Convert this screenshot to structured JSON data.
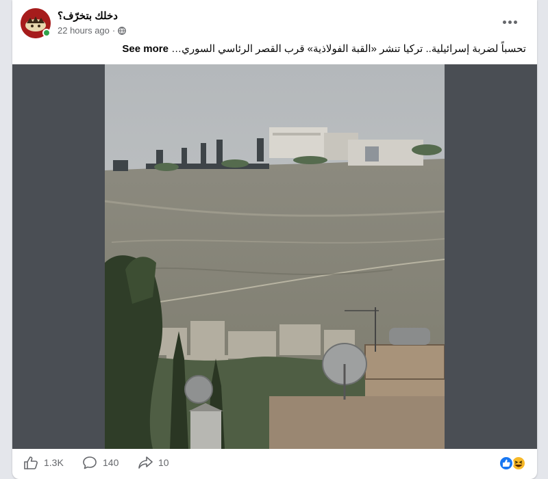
{
  "post": {
    "page_name": "دخلك بتخرّف؟",
    "timestamp": "22 hours ago",
    "separator": "·",
    "privacy_icon": "globe-icon",
    "caption_text": "تحسباً لضربة إسرائيلية.. تركيا تنشر «القبة الفولاذية» قرب القصر الرئاسي السوري…",
    "see_more_label": "See more"
  },
  "footer": {
    "likes_count": "1.3K",
    "comments_count": "140",
    "shares_count": "10",
    "reactions": [
      "like-reaction-icon",
      "haha-reaction-icon"
    ]
  },
  "colors": {
    "online": "#31a24c",
    "like_blue": "#1877f2",
    "haha_yellow": "#f7b928",
    "avatar_red": "#a61c1c"
  }
}
